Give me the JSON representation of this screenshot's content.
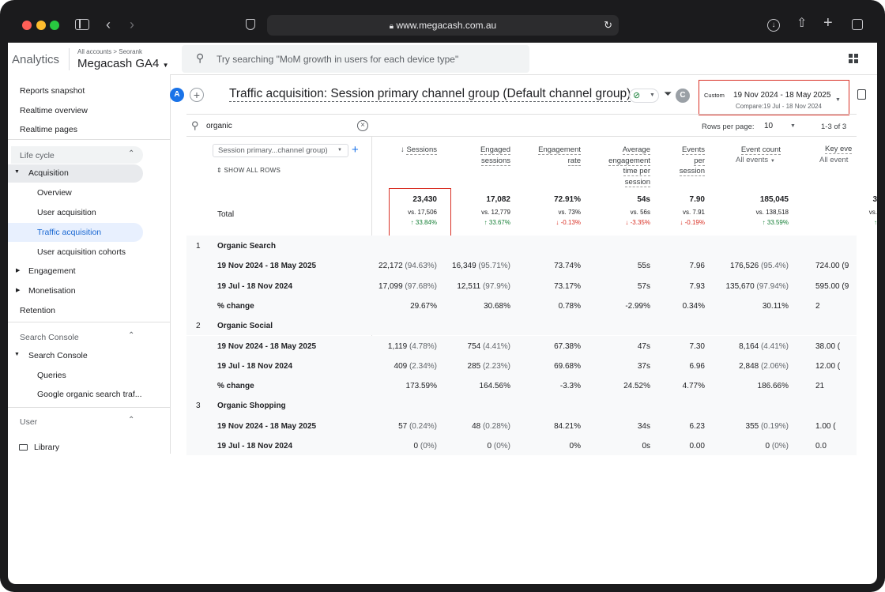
{
  "browser": {
    "url": "www.megacash.com.au"
  },
  "app": {
    "name": "Analytics",
    "breadcrumb": "All accounts > Seorank",
    "property": "Megacash GA4",
    "search_placeholder": "Try searching \"MoM growth in users for each device type\""
  },
  "sidebar": {
    "items": [
      "Reports snapshot",
      "Realtime overview",
      "Realtime pages"
    ],
    "lifecycle": "Life cycle",
    "acquisition": "Acquisition",
    "acq_items": [
      "Overview",
      "User acquisition",
      "Traffic acquisition",
      "User acquisition cohorts"
    ],
    "engagement": "Engagement",
    "monetisation": "Monetisation",
    "retention": "Retention",
    "search_console_section": "Search Console",
    "search_console": "Search Console",
    "sc_items": [
      "Queries",
      "Google organic search traf..."
    ],
    "user_section": "User",
    "library": "Library"
  },
  "report": {
    "avatar": "A",
    "avatar2": "C",
    "title": "Traffic acquisition: Session primary channel group (Default channel group)",
    "date_label": "Custom",
    "date_range": "19 Nov 2024 - 18 May 2025",
    "compare": "Compare:19 Jul - 18 Nov 2024",
    "search_value": "organic",
    "rows_per_page_label": "Rows per page:",
    "rows_per_page": "10",
    "pagination": "1-3 of 3",
    "dimension_select": "Session primary...channel group)",
    "show_all_rows": "SHOW ALL ROWS"
  },
  "columns": {
    "sessions": "Sessions",
    "engaged1": "Engaged",
    "engaged2": "sessions",
    "rate1": "Engagement",
    "rate2": "rate",
    "avg1": "Average",
    "avg2": "engagement",
    "avg3": "time per",
    "avg4": "session",
    "ev1": "Events",
    "ev2": "per",
    "ev3": "session",
    "count1": "Event count",
    "count2": "All events",
    "key1": "Key eve",
    "key2": "All event"
  },
  "total": {
    "label": "Total",
    "sessions": "23,430",
    "sessions_vs": "vs. 17,506",
    "sessions_ch": "↑ 33.84%",
    "engaged": "17,082",
    "engaged_vs": "vs. 12,779",
    "engaged_ch": "↑ 33.67%",
    "rate": "72.91%",
    "rate_vs": "vs. 73%",
    "rate_ch": "↓ -0.13%",
    "avg": "54s",
    "avg_vs": "vs. 56s",
    "avg_ch": "↓ -3.35%",
    "ev": "7.90",
    "ev_vs": "vs. 7.91",
    "ev_ch": "↓ -0.19%",
    "count": "185,045",
    "count_vs": "vs. 138,518",
    "count_ch": "↑ 33.59%",
    "key": "3",
    "key_vs": "vs.",
    "key_ch": "↑"
  },
  "groups": [
    {
      "num": "1",
      "name": "Organic Search"
    },
    {
      "num": "2",
      "name": "Organic Social"
    },
    {
      "num": "3",
      "name": "Organic Shopping"
    }
  ],
  "rows": [
    {
      "label": "19 Nov 2024 - 18 May 2025",
      "c1": "22,172",
      "c1p": "(94.63%)",
      "c2": "16,349",
      "c2p": "(95.71%)",
      "c3": "73.74%",
      "c4": "55s",
      "c5": "7.96",
      "c6": "176,526",
      "c6p": "(95.4%)",
      "c7": "724.00 (9"
    },
    {
      "label": "19 Jul - 18 Nov 2024",
      "c1": "17,099",
      "c1p": "(97.68%)",
      "c2": "12,511",
      "c2p": "(97.9%)",
      "c3": "73.17%",
      "c4": "57s",
      "c5": "7.93",
      "c6": "135,670",
      "c6p": "(97.94%)",
      "c7": "595.00 (9"
    },
    {
      "label": "% change",
      "c1": "29.67%",
      "c1p": "",
      "c2": "30.68%",
      "c2p": "",
      "c3": "0.78%",
      "c4": "-2.99%",
      "c5": "0.34%",
      "c6": "30.11%",
      "c6p": "",
      "c7": "2"
    },
    {
      "label": "19 Nov 2024 - 18 May 2025",
      "c1": "1,119",
      "c1p": "(4.78%)",
      "c2": "754",
      "c2p": "(4.41%)",
      "c3": "67.38%",
      "c4": "47s",
      "c5": "7.30",
      "c6": "8,164",
      "c6p": "(4.41%)",
      "c7": "38.00 ("
    },
    {
      "label": "19 Jul - 18 Nov 2024",
      "c1": "409",
      "c1p": "(2.34%)",
      "c2": "285",
      "c2p": "(2.23%)",
      "c3": "69.68%",
      "c4": "37s",
      "c5": "6.96",
      "c6": "2,848",
      "c6p": "(2.06%)",
      "c7": "12.00 ("
    },
    {
      "label": "% change",
      "c1": "173.59%",
      "c1p": "",
      "c2": "164.56%",
      "c2p": "",
      "c3": "-3.3%",
      "c4": "24.52%",
      "c5": "4.77%",
      "c6": "186.66%",
      "c6p": "",
      "c7": "21"
    },
    {
      "label": "19 Nov 2024 - 18 May 2025",
      "c1": "57",
      "c1p": "(0.24%)",
      "c2": "48",
      "c2p": "(0.28%)",
      "c3": "84.21%",
      "c4": "34s",
      "c5": "6.23",
      "c6": "355",
      "c6p": "(0.19%)",
      "c7": "1.00 ("
    },
    {
      "label": "19 Jul - 18 Nov 2024",
      "c1": "0",
      "c1p": "(0%)",
      "c2": "0",
      "c2p": "(0%)",
      "c3": "0%",
      "c4": "0s",
      "c5": "0.00",
      "c6": "0",
      "c6p": "(0%)",
      "c7": "0.0"
    }
  ],
  "colors": {
    "accent": "#1a73e8",
    "highlight": "#e8f0fe",
    "red_box": "#d93025"
  }
}
